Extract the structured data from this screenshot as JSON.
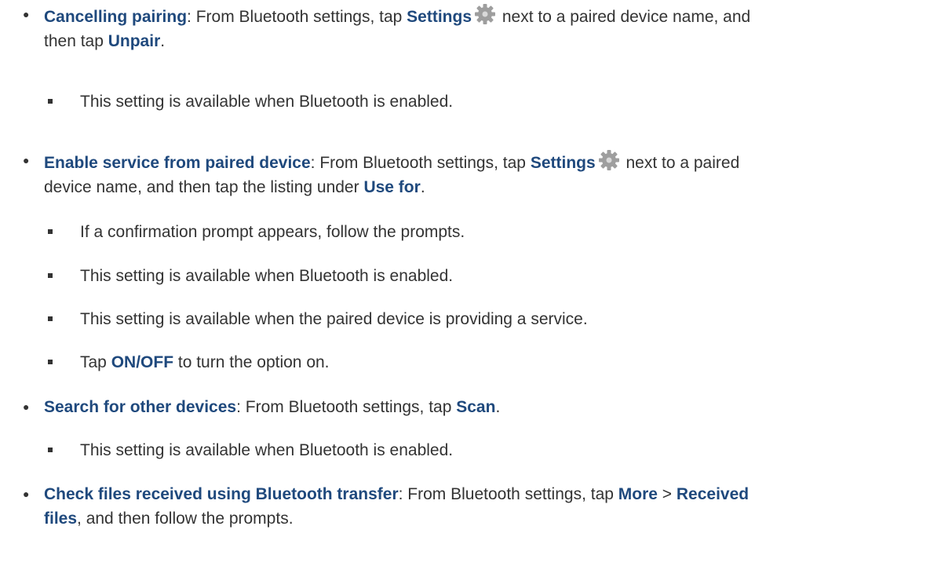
{
  "items": [
    {
      "title": "Cancelling pairing",
      "t1": ": From Bluetooth settings, tap ",
      "k1": "Settings",
      "icon": "gear-icon",
      "t2": " next to a paired device name, and",
      "t3": "then tap ",
      "k2": "Unpair",
      "t4": ".",
      "sub": [
        "This setting is available when Bluetooth is enabled."
      ]
    },
    {
      "title": "Enable service from paired device",
      "t1": ": From Bluetooth settings, tap ",
      "k1": "Settings",
      "icon": "gear-icon",
      "t2": " next to a paired",
      "t3": "device name, and then tap the listing under ",
      "k2": "Use for",
      "t4": ".",
      "sub": [
        "If a confirmation prompt appears, follow the prompts.",
        "This setting is available when Bluetooth is enabled.",
        "This setting is available when the paired device is providing a service."
      ],
      "sub_last": {
        "t1": "Tap ",
        "k1": "ON/OFF",
        "t2": " to turn the option on."
      }
    },
    {
      "title": "Search for other devices",
      "t1": ": From Bluetooth settings, tap ",
      "k1": "Scan",
      "t2": ".",
      "sub": [
        "This setting is available when Bluetooth is enabled."
      ]
    },
    {
      "title": "Check files received using Bluetooth transfer",
      "t1": ": From Bluetooth settings, tap ",
      "k1": "More",
      "t2": " > ",
      "k2": "Received",
      "k3": "files",
      "t3": ", and then follow the prompts."
    }
  ],
  "colors": {
    "heading": "#1f497d",
    "body_text": "#333333",
    "icon": "#9e9e9e"
  }
}
